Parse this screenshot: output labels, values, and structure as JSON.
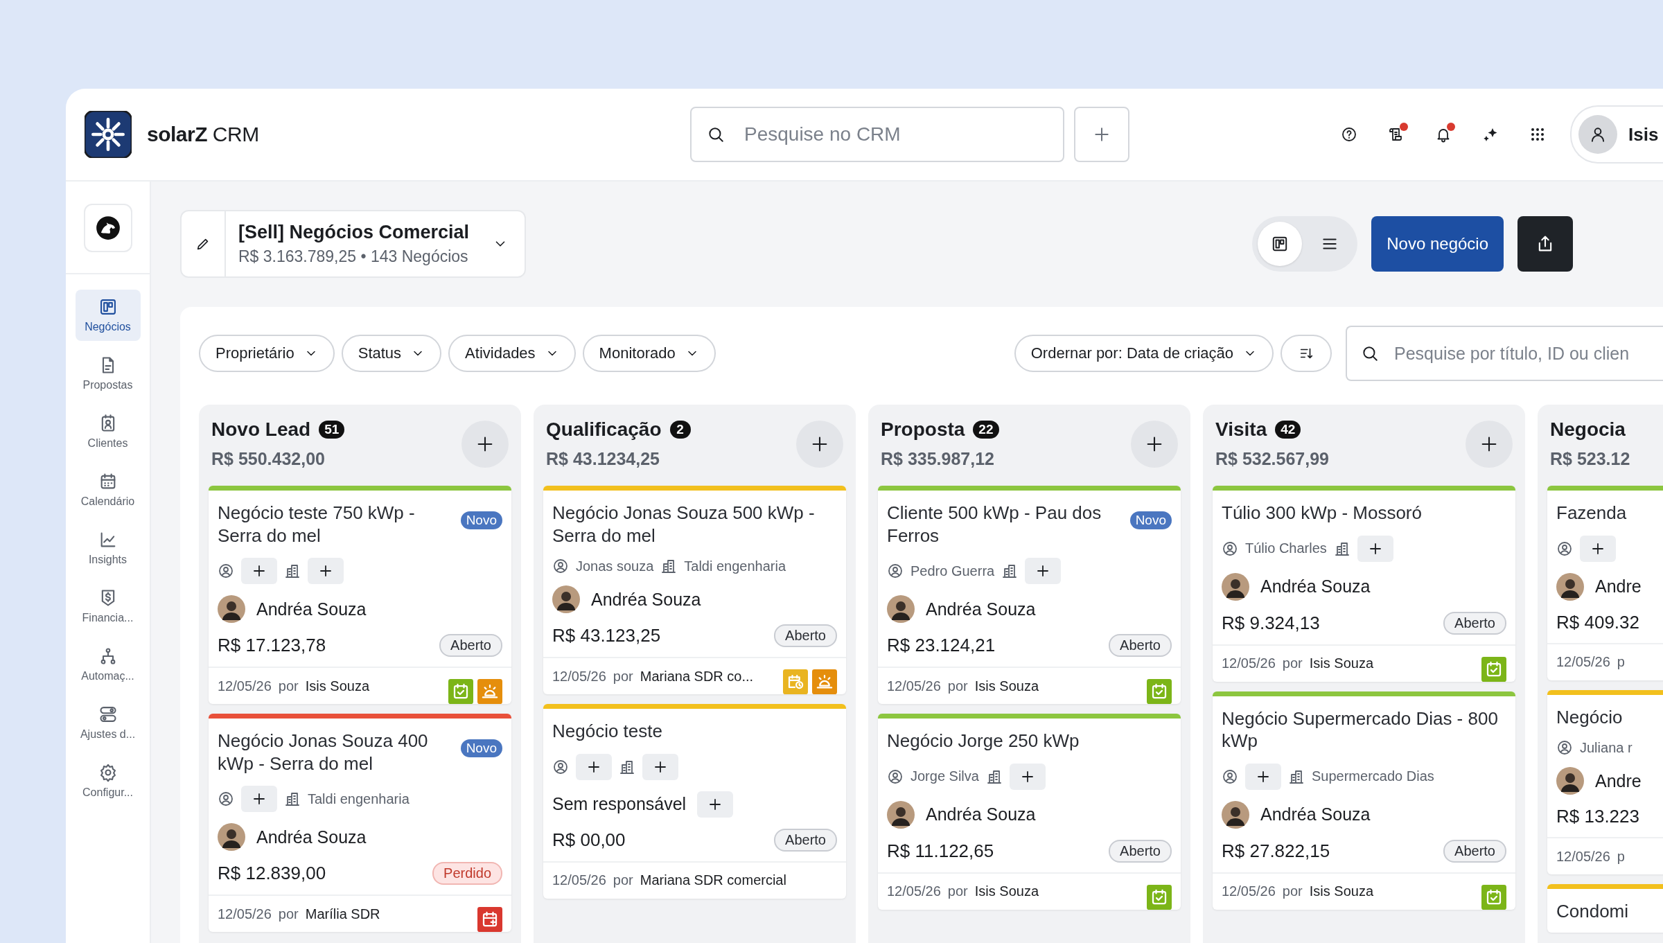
{
  "app": {
    "name": "**solarZ** CRM"
  },
  "header": {
    "search": {
      "placeholder": "Pesquise no CRM"
    },
    "icons": [
      {
        "kind": "help"
      },
      {
        "kind": "document",
        "dot": true
      },
      {
        "kind": "bell",
        "dot": true
      },
      {
        "kind": "sparkle"
      },
      {
        "kind": "apps"
      }
    ],
    "user": {
      "name": "Isis"
    }
  },
  "sidebar": {
    "items": [
      {
        "kind": "board",
        "label": "Negócios",
        "selected": true
      },
      {
        "kind": "document",
        "label": "Propostas",
        "selected": false
      },
      {
        "kind": "contact",
        "label": "Clientes",
        "selected": false
      },
      {
        "kind": "calendar",
        "label": "Calendário",
        "selected": false
      },
      {
        "kind": "chart",
        "label": "Insights",
        "selected": false
      },
      {
        "kind": "finance",
        "label": "Financia...",
        "selected": false
      },
      {
        "kind": "automation",
        "label": "Automaç...",
        "selected": false
      },
      {
        "kind": "toggles",
        "label": "Ajustes d...",
        "selected": false
      },
      {
        "kind": "settings",
        "label": "Configur...",
        "selected": false
      }
    ]
  },
  "pipeline": {
    "title": "[Sell] Negócios Comercial",
    "total": "R$ 3.163.789,25",
    "separator": "•",
    "count": "143 Negócios"
  },
  "views": [
    {
      "kind": "board",
      "selected": true
    },
    {
      "kind": "list",
      "selected": false
    }
  ],
  "new_button": "Novo negócio",
  "filters": [
    "Proprietário",
    "Status",
    "Atividades",
    "Monitorado"
  ],
  "sort": {
    "label": "Ordernar por: Data de criação"
  },
  "board_search": {
    "placeholder": "Pesquise por título, ID ou clien"
  },
  "columns": [
    {
      "title": "Novo Lead",
      "count": "51",
      "total": "R$ 550.432,00",
      "add_button": true,
      "cards": [
        {
          "title": "Negócio teste 750 kWp - Serra do mel",
          "color": "#8cc63f",
          "badge": "Novo",
          "meta": [
            {
              "kind": "contact"
            },
            {
              "kind": "company"
            }
          ],
          "owner": {
            "kind": "person",
            "label": "Andréa Souza"
          },
          "value": "R$ 17.123,78",
          "status": {
            "kind": "open",
            "label": "Aberto"
          },
          "date": "12/05/26",
          "by_label": "por",
          "by": "Isis Souza",
          "activities": [
            {
              "kind": "done"
            },
            {
              "kind": "alarm"
            }
          ]
        },
        {
          "title": "Negócio Jonas Souza 400 kWp - Serra do mel",
          "color": "#e8503a",
          "badge": "Novo",
          "meta": [
            {
              "kind": "contact"
            },
            {
              "kind": "company",
              "label": "Taldi engenharia"
            }
          ],
          "owner": {
            "kind": "person",
            "label": "Andréa Souza"
          },
          "value": "R$ 12.839,00",
          "status": {
            "kind": "lost",
            "label": "Perdido"
          },
          "date": "12/05/26",
          "by_label": "por",
          "by": "Marília SDR",
          "activities": [
            {
              "kind": "overdue"
            }
          ]
        }
      ]
    },
    {
      "title": "Qualificação",
      "count": "2",
      "total": "R$ 43.1234,25",
      "add_button": true,
      "cards": [
        {
          "title": "Negócio Jonas Souza 500 kWp - Serra do mel",
          "color": "#f2c01d",
          "meta": [
            {
              "kind": "contact",
              "label": "Jonas souza"
            },
            {
              "kind": "company",
              "label": "Taldi engenharia"
            }
          ],
          "owner": {
            "kind": "person",
            "label": "Andréa Souza"
          },
          "value": "R$ 43.123,25",
          "status": {
            "kind": "open",
            "label": "Aberto"
          },
          "date": "12/05/26",
          "by_label": "por",
          "by": "Mariana SDR co...",
          "activities": [
            {
              "kind": "scheduled"
            },
            {
              "kind": "alarm"
            }
          ]
        },
        {
          "title": "Negócio teste",
          "color": "#f2c01d",
          "meta": [
            {
              "kind": "contact"
            },
            {
              "kind": "company"
            }
          ],
          "owner": {
            "kind": "unassigned",
            "label": "Sem responsável"
          },
          "value": "R$ 00,00",
          "status": {
            "kind": "open",
            "label": "Aberto"
          },
          "date": "12/05/26",
          "by_label": "por",
          "by": "Mariana SDR comercial"
        }
      ]
    },
    {
      "title": "Proposta",
      "count": "22",
      "total": "R$ 335.987,12",
      "add_button": true,
      "cards": [
        {
          "title": "Cliente 500 kWp - Pau dos Ferros",
          "color": "#8cc63f",
          "badge": "Novo",
          "meta": [
            {
              "kind": "contact",
              "label": "Pedro Guerra"
            },
            {
              "kind": "company"
            }
          ],
          "owner": {
            "kind": "person",
            "label": "Andréa Souza"
          },
          "value": "R$ 23.124,21",
          "status": {
            "kind": "open",
            "label": "Aberto"
          },
          "date": "12/05/26",
          "by_label": "por",
          "by": "Isis Souza",
          "activities": [
            {
              "kind": "done"
            }
          ]
        },
        {
          "title": "Negócio Jorge 250 kWp",
          "color": "#8cc63f",
          "meta": [
            {
              "kind": "contact",
              "label": "Jorge Silva"
            },
            {
              "kind": "company"
            }
          ],
          "owner": {
            "kind": "person",
            "label": "Andréa Souza"
          },
          "value": "R$ 11.122,65",
          "status": {
            "kind": "open",
            "label": "Aberto"
          },
          "date": "12/05/26",
          "by_label": "por",
          "by": "Isis Souza",
          "activities": [
            {
              "kind": "done"
            }
          ]
        }
      ]
    },
    {
      "title": "Visita",
      "count": "42",
      "total": "R$ 532.567,99",
      "add_button": true,
      "cards": [
        {
          "title": "Túlio 300 kWp - Mossoró",
          "color": "#8cc63f",
          "meta": [
            {
              "kind": "contact",
              "label": "Túlio Charles"
            },
            {
              "kind": "company"
            }
          ],
          "owner": {
            "kind": "person",
            "label": "Andréa Souza"
          },
          "value": "R$ 9.324,13",
          "status": {
            "kind": "open",
            "label": "Aberto"
          },
          "date": "12/05/26",
          "by_label": "por",
          "by": "Isis Souza",
          "activities": [
            {
              "kind": "done"
            }
          ]
        },
        {
          "title": "Negócio Supermercado Dias - 800 kWp",
          "color": "#8cc63f",
          "meta": [
            {
              "kind": "contact"
            },
            {
              "kind": "company",
              "label": "Supermercado Dias"
            }
          ],
          "owner": {
            "kind": "person",
            "label": "Andréa Souza"
          },
          "value": "R$ 27.822,15",
          "status": {
            "kind": "open",
            "label": "Aberto"
          },
          "date": "12/05/26",
          "by_label": "por",
          "by": "Isis Souza",
          "activities": [
            {
              "kind": "done"
            }
          ]
        }
      ]
    },
    {
      "title": "Negocia",
      "total": "R$ 523.12",
      "add_button": false,
      "cards": [
        {
          "title": "Fazenda",
          "color": "#8cc63f",
          "meta": [
            {
              "kind": "contact"
            }
          ],
          "owner": {
            "kind": "person",
            "label": "Andre"
          },
          "value": "R$ 409.32",
          "date": "12/05/26",
          "by_label": "p"
        },
        {
          "title": "Negócio",
          "color": "#f2c01d",
          "meta": [
            {
              "kind": "contact",
              "label": "Juliana r"
            }
          ],
          "owner": {
            "kind": "person",
            "label": "Andre"
          },
          "value": "R$ 13.223",
          "date": "12/05/26",
          "by_label": "p"
        },
        {
          "title": "Condomi",
          "color": "#f2c01d"
        }
      ]
    }
  ]
}
